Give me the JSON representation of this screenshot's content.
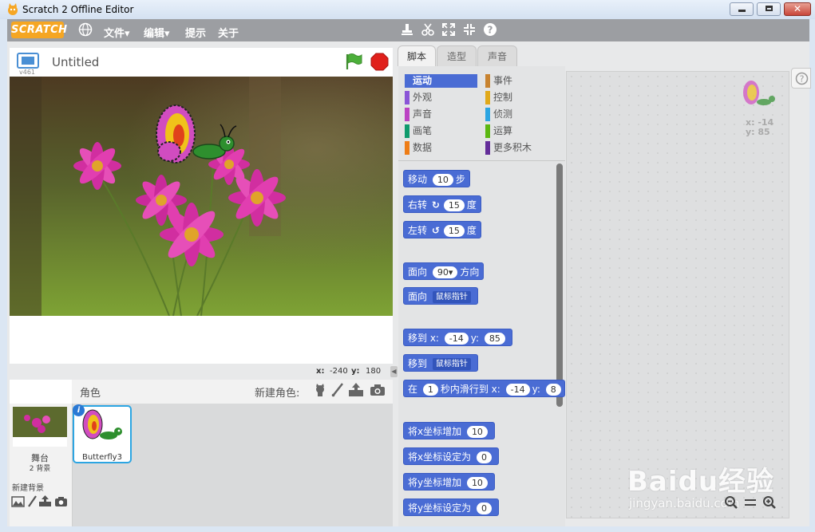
{
  "window": {
    "title": "Scratch 2 Offline Editor",
    "controls": [
      "minimize",
      "maximize",
      "close"
    ]
  },
  "menubar": {
    "logo": "SCRATCH",
    "items": [
      "文件▾",
      "编辑▾",
      "提示",
      "关于"
    ],
    "tools": [
      "duplicate-icon",
      "cut-icon",
      "grow-icon",
      "shrink-icon",
      "help-icon"
    ]
  },
  "stage": {
    "version": "v461",
    "project_title": "Untitled",
    "coords": {
      "x_label": "x:",
      "x_value": "-240",
      "y_label": "y:",
      "y_value": "180"
    }
  },
  "sprites": {
    "header": "角色",
    "new_sprite_label": "新建角色:",
    "stage_label": "舞台",
    "backdrop_count": "2 背景",
    "new_backdrop_label": "新建背景",
    "items": [
      {
        "name": "Butterfly3"
      }
    ]
  },
  "tabs": [
    "脚本",
    "造型",
    "声音"
  ],
  "categories": {
    "left": [
      {
        "label": "运动",
        "color": "#4a6cd4",
        "selected": true
      },
      {
        "label": "外观",
        "color": "#8a55d7"
      },
      {
        "label": "声音",
        "color": "#bb42c3"
      },
      {
        "label": "画笔",
        "color": "#0e9a6c"
      },
      {
        "label": "数据",
        "color": "#ee7d16"
      }
    ],
    "right": [
      {
        "label": "事件",
        "color": "#c88330"
      },
      {
        "label": "控制",
        "color": "#e1a91a"
      },
      {
        "label": "侦测",
        "color": "#2ca5e2"
      },
      {
        "label": "运算",
        "color": "#5cb712"
      },
      {
        "label": "更多积木",
        "color": "#632d99"
      }
    ]
  },
  "blocks": [
    {
      "pre": "移动",
      "a": "10",
      "post": "步"
    },
    {
      "pre": "右转",
      "sym": "↻",
      "a": "15",
      "post": "度"
    },
    {
      "pre": "左转",
      "sym": "↺",
      "a": "15",
      "post": "度"
    },
    {
      "pre": "面向",
      "a": "90▾",
      "post": "方向"
    },
    {
      "pre": "面向",
      "dd": "鼠标指针"
    },
    {
      "pre": "移到 x:",
      "a": "-14",
      "mid": "y:",
      "b": "85"
    },
    {
      "pre": "移到",
      "dd": "鼠标指针"
    },
    {
      "pre": "在",
      "a": "1",
      "mid": "秒内滑行到 x:",
      "b": "-14",
      "mid2": "y:",
      "c": "8"
    },
    {
      "pre": "将x坐标增加",
      "a": "10"
    },
    {
      "pre": "将x坐标设定为",
      "a": "0"
    },
    {
      "pre": "将y坐标增加",
      "a": "10"
    },
    {
      "pre": "将y坐标设定为",
      "a": "0"
    }
  ],
  "sprite_info": {
    "x": "x: -14",
    "y": "y: 85"
  },
  "watermark": {
    "brand": "Baidu经验",
    "url": "jingyan.baidu.com"
  },
  "colors": {
    "accent": "#4a6cd4",
    "menubar": "#9c9ea2",
    "flag": "#3f8d2f",
    "stop": "#e0201b"
  }
}
